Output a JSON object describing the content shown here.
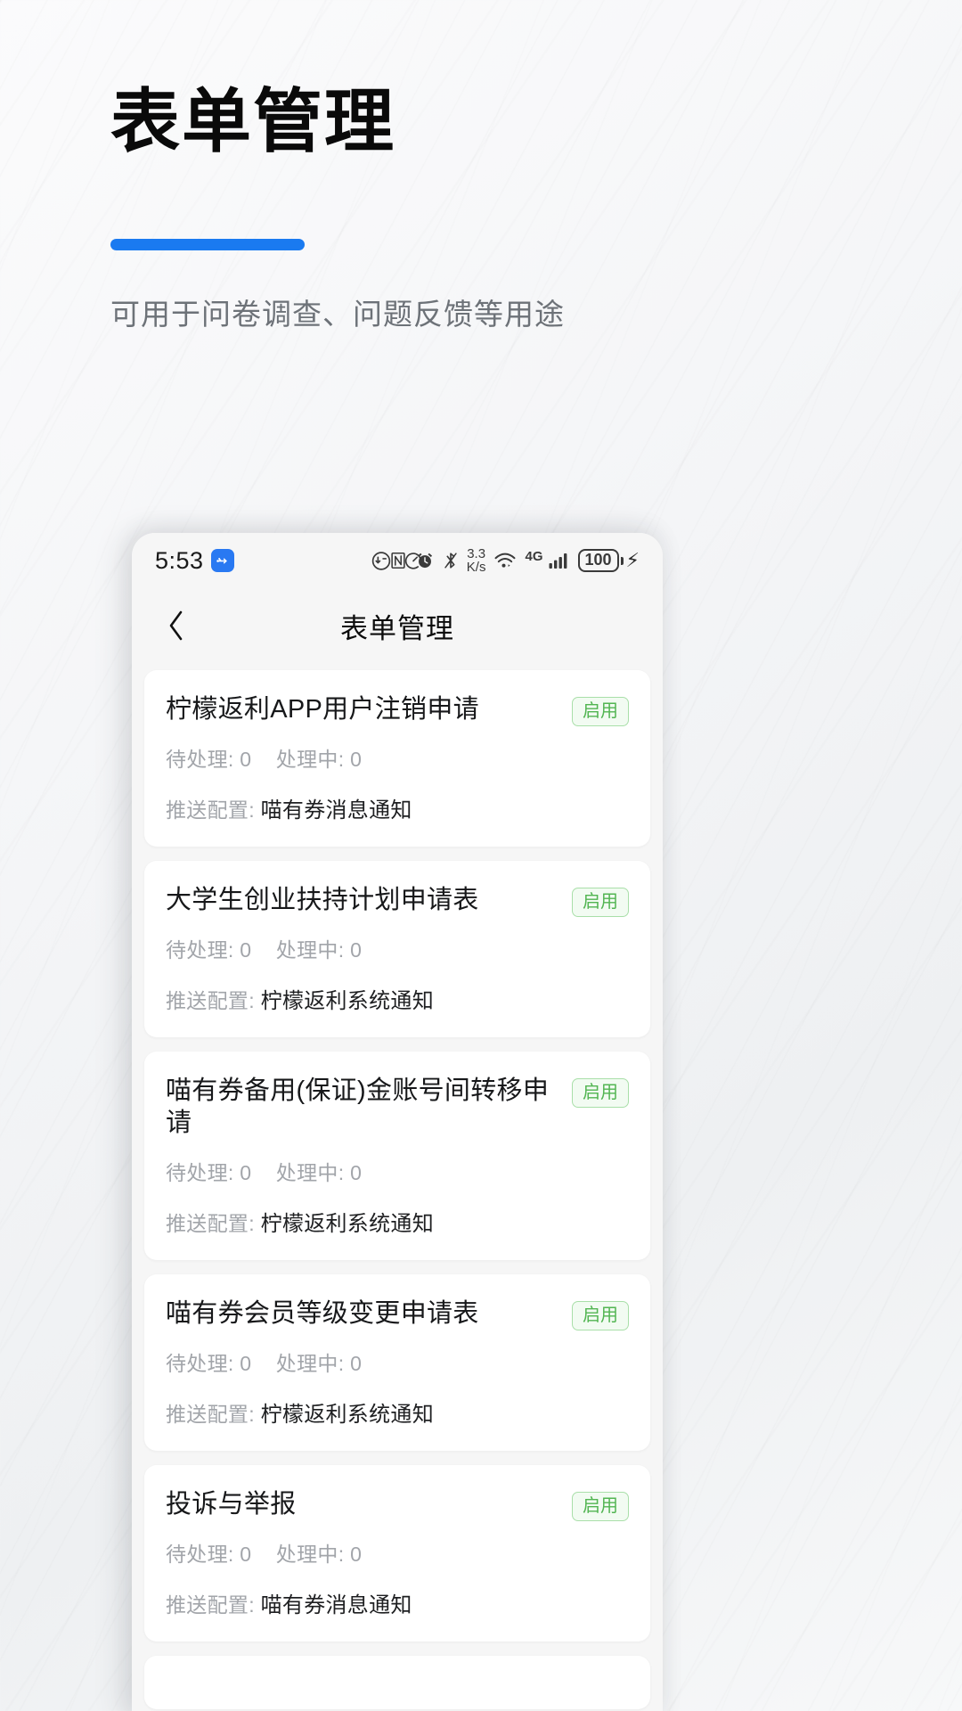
{
  "hero": {
    "title": "表单管理",
    "subtitle": "可用于问卷调查、问题反馈等用途",
    "accent_color": "#1a7af0",
    "title_color": "#0a0a0a",
    "subtitle_color": "#6d7278"
  },
  "phone": {
    "status_bar": {
      "time": "5:53",
      "usb_icon": "usb-icon",
      "usb_badge_color": "#2979f2",
      "middle_icons": [
        "data-saver-icon",
        "speedometer-icon"
      ],
      "right_icons": [
        "nfc-icon",
        "alarm-icon",
        "bluetooth-icon"
      ],
      "network_speed": "3.3",
      "network_speed_unit": "K/s",
      "wifi_icon": "wifi-icon",
      "mobile_network_label": "4G",
      "signal_icon": "signal-bars-icon",
      "battery_level": "100",
      "charging_icon": "lightning-bolt-icon"
    },
    "nav": {
      "back_icon": "chevron-left-icon",
      "title": "表单管理"
    },
    "list": {
      "labels": {
        "pending": "待处理:",
        "processing": "处理中:",
        "push_config": "推送配置:"
      },
      "items": [
        {
          "title": "柠檬返利APP用户注销申请",
          "status": "启用",
          "pending": "0",
          "processing": "0",
          "push_config": "喵有券消息通知"
        },
        {
          "title": "大学生创业扶持计划申请表",
          "status": "启用",
          "pending": "0",
          "processing": "0",
          "push_config": "柠檬返利系统通知"
        },
        {
          "title": "喵有券备用(保证)金账号间转移申请",
          "status": "启用",
          "pending": "0",
          "processing": "0",
          "push_config": "柠檬返利系统通知"
        },
        {
          "title": "喵有券会员等级变更申请表",
          "status": "启用",
          "pending": "0",
          "processing": "0",
          "push_config": "柠檬返利系统通知"
        },
        {
          "title": "投诉与举报",
          "status": "启用",
          "pending": "0",
          "processing": "0",
          "push_config": "喵有券消息通知"
        }
      ]
    }
  }
}
